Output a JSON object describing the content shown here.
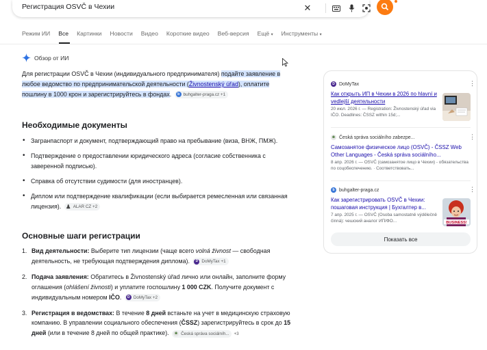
{
  "search": {
    "query": "Регистрация OSVČ в Чехии"
  },
  "tabs": [
    "Режим ИИ",
    "Все",
    "Картинки",
    "Новости",
    "Видео",
    "Короткие видео",
    "Веб-версия",
    "Ещё",
    "Инструменты"
  ],
  "ai": {
    "header": "Обзор от ИИ",
    "intro_plain": "Для регистрации OSVČ в Чехии (индивидуального предпринимателя) ",
    "intro_hl1": "подайте заявление в любое ведомство по предпринимательской деятельности (",
    "intro_link": "Živnostenský úřad",
    "intro_hl2": "), оплатите пошлину в 1000 крон и зарегистрируйтесь в фондах",
    "intro_end": ".",
    "intro_chip": "buhgalter-praga.cz +1"
  },
  "docs": {
    "title": "Необходимые документы",
    "items": [
      "Загранпаспорт и документ, подтверждающий право на пребывание (виза, ВНЖ, ПМЖ).",
      "Подтверждение о предоставлении юридического адреса (согласие собственника с заверенной подписью).",
      "Справка об отсутствии судимости (для иностранцев).",
      "Диплом или подтверждение квалификации (если выбирается ремесленная или связанная лицензия)."
    ],
    "item4_chip": "ALAR CZ +2"
  },
  "steps": {
    "title": "Основные шаги регистрации",
    "s1_num": "1.",
    "s1_bold": "Вид деятельности:",
    "s1_text_a": " Выберите тип лицензии (чаще всего ",
    "s1_ital": "volná živnost",
    "s1_text_b": " — свободная деятельность, не требующая подтверждения диплома).",
    "s1_chip": "DoMyTax +1",
    "s2_num": "2.",
    "s2_bold": "Подача заявления:",
    "s2_text_a": " Обратитесь в Živnostenský úřad лично или онлайн, заполните форму оглашения (",
    "s2_ital": "ohlášení živnosti",
    "s2_text_b": ") и уплатите госпошлину ",
    "s2_bold2": "1 000 CZK",
    "s2_text_c": ". Получите документ с индивидуальным номером ",
    "s2_bold3": "IČO",
    "s2_text_d": ".",
    "s2_chip": "DoMyTax +2",
    "s3_num": "3.",
    "s3_bold": "Регистрация в ведомствах:",
    "s3_text_a": " В течение ",
    "s3_bold2": "8 дней",
    "s3_text_b": " встаньте на учет в медицинскую страховую компанию. В управлении социального обеспечения (",
    "s3_bold3": "ČSSZ",
    "s3_text_c": ") зарегистрируйтесь в срок до ",
    "s3_bold4": "15 дней",
    "s3_text_d": " (или в течение 8 дней по общей практике).",
    "s3_chip": "Česká správa sociálníh...",
    "s3_chip_more": "+3"
  },
  "sources": [
    {
      "site": "DoMyTax",
      "title": "Как открыть ИП в Чехии в 2026 по hlavní и vedlejší деятельности",
      "snippet": "20 июл. 2026 г. — Registration: Živnostenský úřad via IČO. Deadlines: ČSSZ within 15d;..."
    },
    {
      "site": "Česká správa sociálního zabezpe...",
      "title": "Самозанятое физическое лицо (OSVČ) - ČSSZ Web Other Languages - Česká správa sociálního...",
      "snippet": "8 апр. 2026 г. — OSVČ (самозанятое лицо в Чехии) - обязательства по соцобеспечению. · Соответствовать..."
    },
    {
      "site": "buhgalter-praga.cz",
      "title": "Как зарегистрировать OSVČ в Чехии: пошаговая инструкция | Бухгалтер в...",
      "snippet": "7 апр. 2025 г. — OSVČ (Osoba samostatně výdělečně činná): чешский аналог ИП/ФО..."
    }
  ],
  "thumb3_caption": "BUSINESS!",
  "show_all": "Показать все",
  "colors": {
    "accent": "#fc7b11",
    "link": "#1a0dab",
    "highlight": "#d3e3fd"
  }
}
